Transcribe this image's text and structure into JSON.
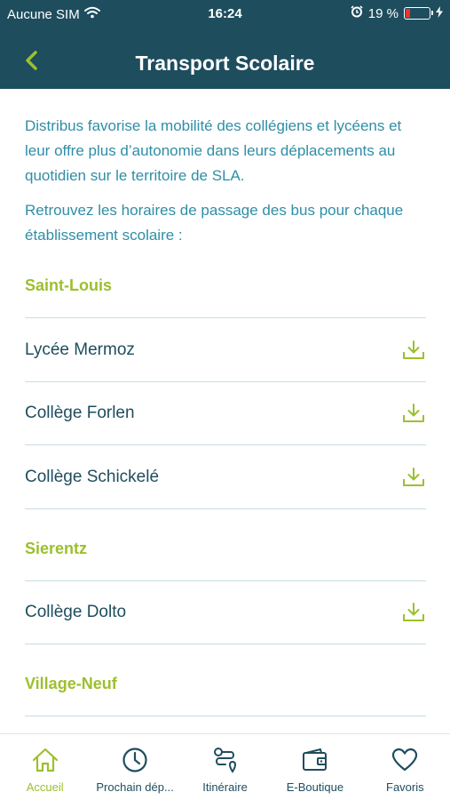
{
  "status_bar": {
    "carrier": "Aucune SIM",
    "time": "16:24",
    "battery_text": "19 %",
    "battery_level": 0.19,
    "icons": [
      "wifi-icon",
      "alarm-icon",
      "battery-icon",
      "charging-icon"
    ]
  },
  "header": {
    "title": "Transport Scolaire",
    "back_icon": "chevron-left-icon"
  },
  "intro": {
    "paragraph_1": "Distribus favorise la mobilité des collégiens et lycéens et leur offre plus d’autonomie dans leurs déplacements au quotidien sur le territoire de SLA.",
    "paragraph_2": "Retrouvez les horaires de passage des bus pour chaque établissement scolaire :"
  },
  "sections": [
    {
      "title": "Saint-Louis",
      "items": [
        {
          "label": "Lycée Mermoz",
          "icon": "download-icon"
        },
        {
          "label": "Collège Forlen",
          "icon": "download-icon"
        },
        {
          "label": "Collège Schickelé",
          "icon": "download-icon"
        }
      ]
    },
    {
      "title": "Sierentz",
      "items": [
        {
          "label": "Collège Dolto",
          "icon": "download-icon"
        }
      ]
    },
    {
      "title": "Village-Neuf",
      "items": []
    }
  ],
  "tabbar": {
    "tabs": [
      {
        "label": "Accueil",
        "icon": "home-icon",
        "active": true
      },
      {
        "label": "Prochain dép...",
        "icon": "clock-icon",
        "active": false
      },
      {
        "label": "Itinéraire",
        "icon": "route-icon",
        "active": false
      },
      {
        "label": "E-Boutique",
        "icon": "wallet-icon",
        "active": false
      },
      {
        "label": "Favoris",
        "icon": "heart-icon",
        "active": false
      }
    ]
  },
  "colors": {
    "header_bg": "#1e4d5e",
    "accent_green": "#9dbf2d",
    "text_teal": "#2f8ea6",
    "text_dark": "#1e4d5e",
    "divider": "#c6dde6",
    "battery_low": "#e8342b"
  }
}
